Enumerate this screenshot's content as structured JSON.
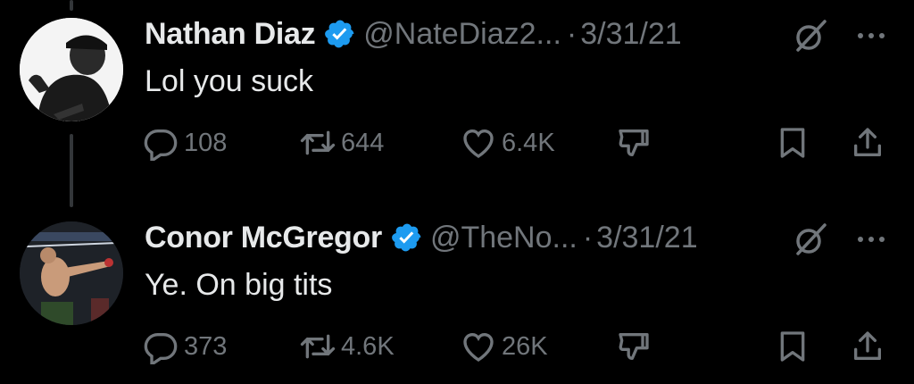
{
  "tweets": [
    {
      "name": "Nathan Diaz",
      "handle": "@NateDiaz2...",
      "date": "3/31/21",
      "text": "Lol you suck",
      "replies": "108",
      "retweets": "644",
      "likes": "6.4K"
    },
    {
      "name": "Conor McGregor",
      "handle": "@TheNo...",
      "date": "3/31/21",
      "text": "Ye. On big tits",
      "replies": "373",
      "retweets": "4.6K",
      "likes": "26K"
    }
  ],
  "separator": "·",
  "icons": [
    "verified-badge-icon",
    "grok-icon",
    "more-icon",
    "reply-icon",
    "retweet-icon",
    "like-icon",
    "dislike-icon",
    "bookmark-icon",
    "share-icon"
  ],
  "colors": {
    "background": "#000000",
    "verified": "#1d9bf0",
    "secondary": "#71767b",
    "primary": "#e7e9ea"
  }
}
